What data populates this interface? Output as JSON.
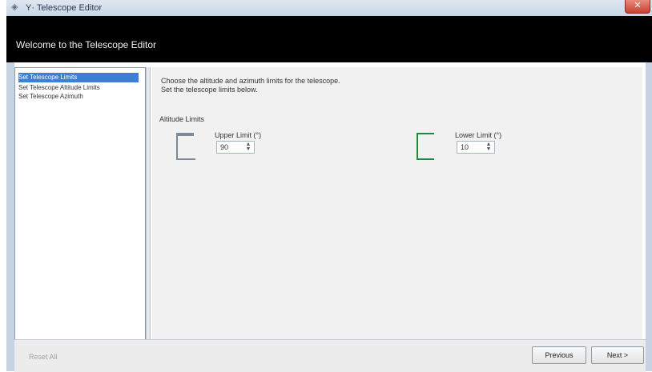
{
  "window": {
    "title": "Y· Telescope Editor",
    "close_glyph": "✕",
    "app_icon": "app-icon"
  },
  "header": {
    "title": "Welcome to the Telescope Editor"
  },
  "sidebar": {
    "items": [
      {
        "label": "Set Telescope Limits",
        "active": true
      },
      {
        "label": "Set Telescope Altitude Limits",
        "active": false
      },
      {
        "label": "Set Telescope Azimuth",
        "active": false
      }
    ]
  },
  "main": {
    "description_line1": "Choose the altitude and azimuth limits for the telescope.",
    "description_line2": "Set the telescope limits below.",
    "section_label": "Altitude Limits",
    "groups": [
      {
        "label": "Upper Limit (°)",
        "value": "90"
      },
      {
        "label": "Lower Limit (°)",
        "value": "10"
      }
    ]
  },
  "footer": {
    "reset_label": "Reset All",
    "previous_label": "Previous",
    "next_label": "Next >"
  },
  "colors": {
    "accent": "#3d7fd6",
    "header": "#000000",
    "green_marker": "#1f8a3c"
  }
}
